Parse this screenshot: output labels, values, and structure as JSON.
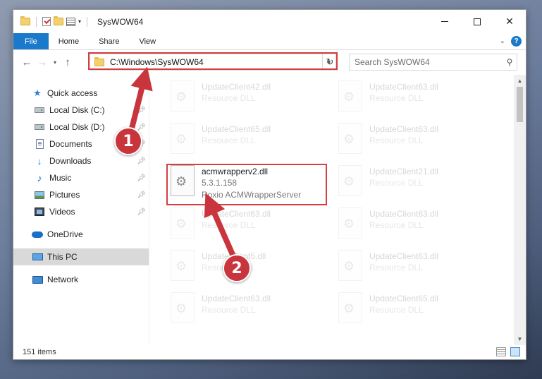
{
  "window": {
    "title": "SysWOW64"
  },
  "ribbon": {
    "tabs": [
      "File",
      "Home",
      "Share",
      "View"
    ]
  },
  "address": {
    "path": "C:\\Windows\\SysWOW64"
  },
  "search": {
    "placeholder": "Search SysWOW64"
  },
  "nav": {
    "quick_access": "Quick access",
    "items": [
      {
        "label": "Local Disk (C:)",
        "icon": "drive-icon"
      },
      {
        "label": "Local Disk (D:)",
        "icon": "drive-icon"
      },
      {
        "label": "Documents",
        "icon": "documents-icon"
      },
      {
        "label": "Downloads",
        "icon": "downloads-icon"
      },
      {
        "label": "Music",
        "icon": "music-icon"
      },
      {
        "label": "Pictures",
        "icon": "pictures-icon"
      },
      {
        "label": "Videos",
        "icon": "videos-icon"
      }
    ],
    "onedrive": "OneDrive",
    "this_pc": "This PC",
    "network": "Network"
  },
  "files": {
    "left_column": [
      {
        "name": "UpdateClient42.dll",
        "meta": "Resource DLL"
      },
      {
        "name": "UpdateClient65.dll",
        "meta": "Resource DLL"
      },
      {
        "name": "acmwrapperv2.dll",
        "version": "5.3.1.158",
        "company": "Roxio ACMWrapperServer"
      },
      {
        "name": "UpdateClient63.dll",
        "meta": "Resource DLL"
      },
      {
        "name": "UpdateClient5.dll",
        "meta": "Resource DLL"
      },
      {
        "name": "UpdateClient63.dll",
        "meta": "Resource DLL"
      }
    ],
    "right_column": [
      {
        "name": "UpdateClient63.dll",
        "meta": "Resource DLL"
      },
      {
        "name": "UpdateClient63.dll",
        "meta": "Resource DLL"
      },
      {
        "name": "UpdateClient21.dll",
        "meta": "Resource DLL"
      },
      {
        "name": "UpdateClient63.dll",
        "meta": "Resource DLL"
      },
      {
        "name": "UpdateClient63.dll",
        "meta": "Resource DLL"
      },
      {
        "name": "UpdateClient65.dll",
        "meta": "Resource DLL"
      }
    ]
  },
  "status": {
    "item_count": "151 items"
  },
  "annotations": {
    "step1": "1",
    "step2": "2",
    "color": "#c9353c"
  }
}
